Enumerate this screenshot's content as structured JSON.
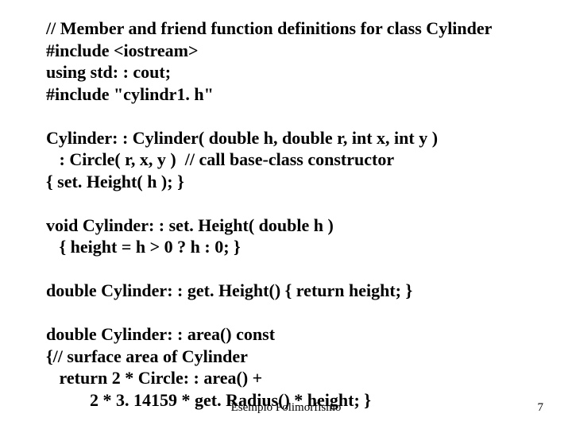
{
  "code": {
    "l1": "// Member and friend function definitions for class Cylinder",
    "l2": "#include <iostream>",
    "l3": "using std: : cout;",
    "l4": "#include \"cylindr1. h\"",
    "l5": "",
    "l6": "Cylinder: : Cylinder( double h, double r, int x, int y )",
    "l7": "   : Circle( r, x, y )  // call base-class constructor",
    "l8": "{ set. Height( h ); }",
    "l9": "",
    "l10": "void Cylinder: : set. Height( double h )",
    "l11": "   { height = h > 0 ? h : 0; }",
    "l12": "",
    "l13": "double Cylinder: : get. Height() { return height; }",
    "l14": "",
    "l15": "double Cylinder: : area() const",
    "l16": "{// surface area of Cylinder",
    "l17": "   return 2 * Circle: : area() +",
    "l18": "          2 * 3. 14159 * get. Radius() * height; }"
  },
  "footer": {
    "center": "Esempio Polimorfismo",
    "page": "7"
  }
}
